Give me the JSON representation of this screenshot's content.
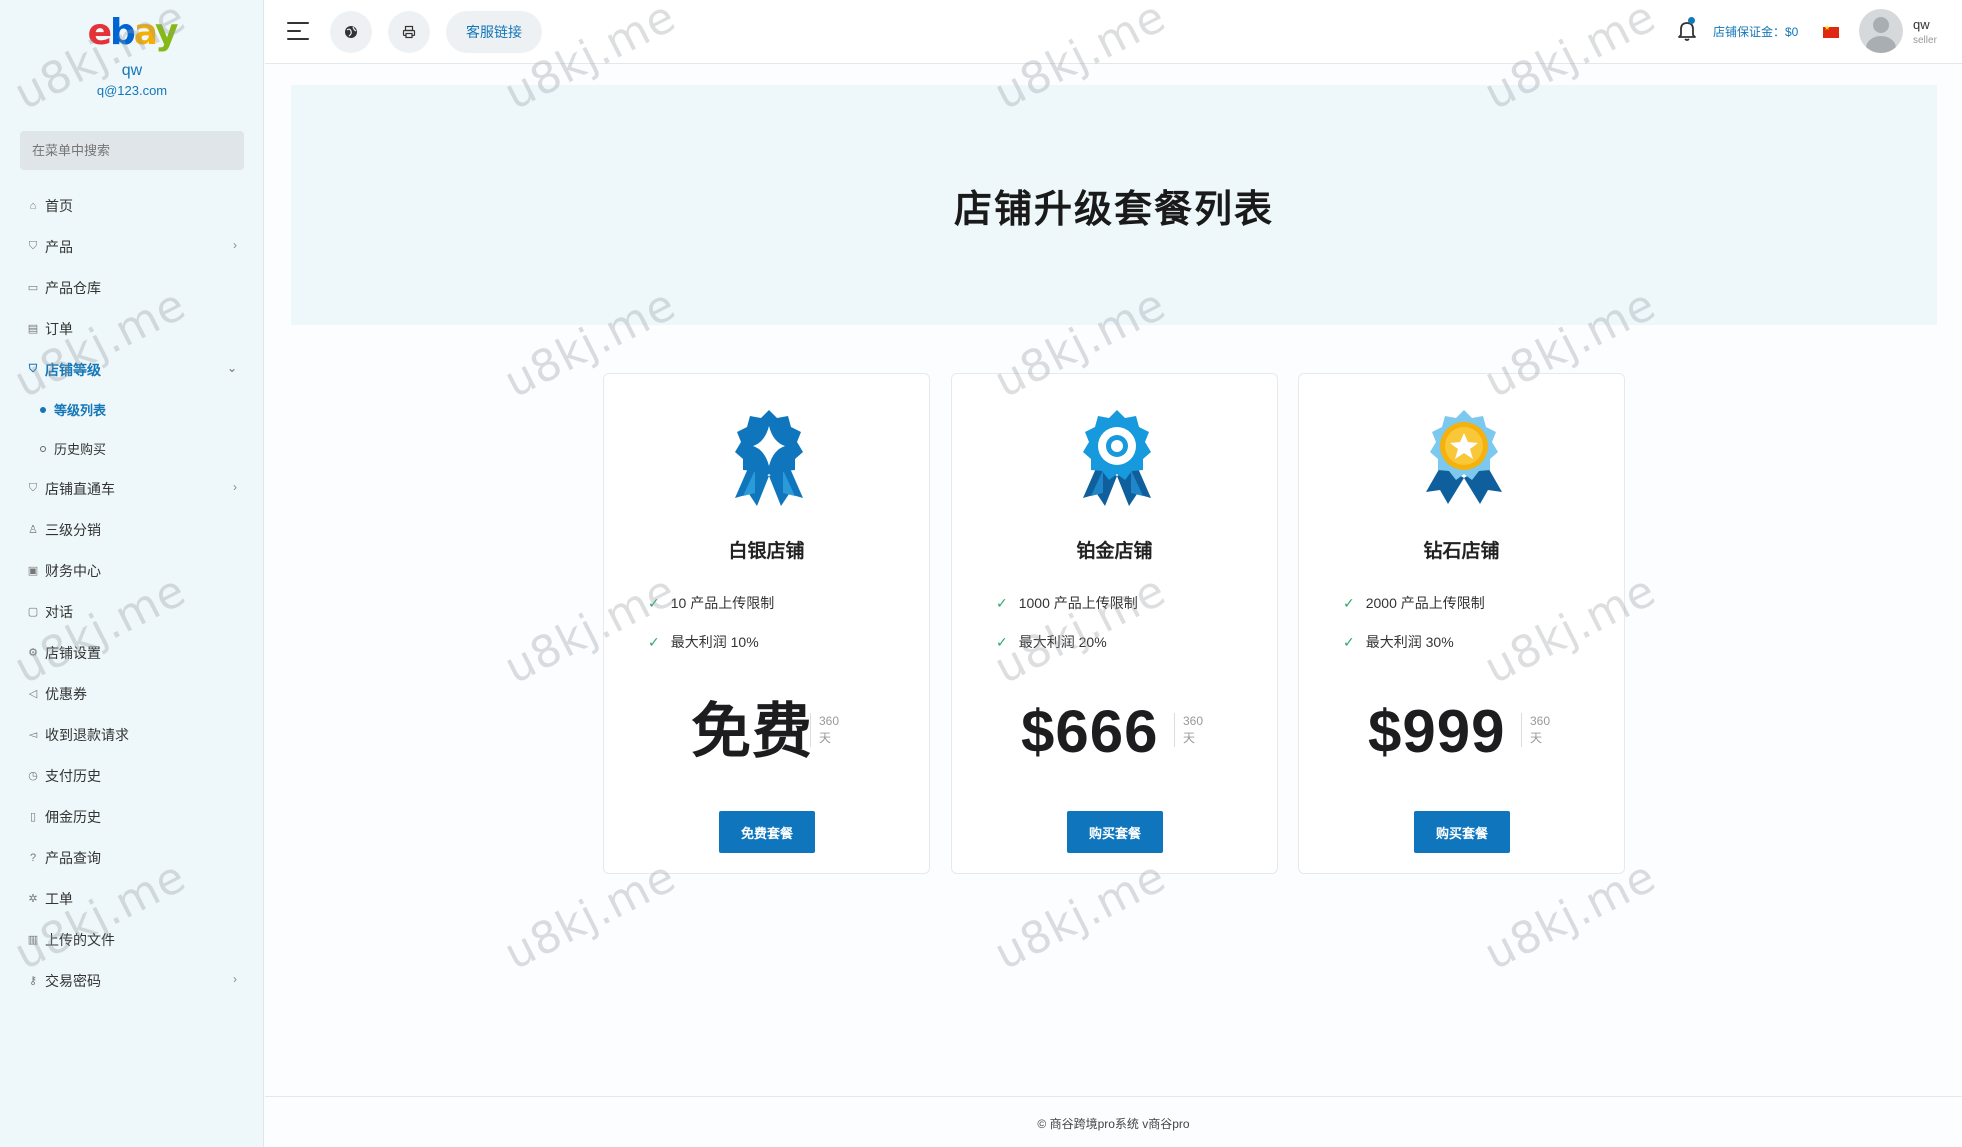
{
  "sidebar": {
    "logo": {
      "e": "e",
      "b": "b",
      "a": "a",
      "y": "y"
    },
    "user_name": "qw",
    "user_email": "q@123.com",
    "search_placeholder": "在菜单中搜索",
    "items": [
      {
        "label": "首页",
        "icon": "home-icon"
      },
      {
        "label": "产品",
        "icon": "cart-icon",
        "expandable": true
      },
      {
        "label": "产品仓库",
        "icon": "warehouse-icon"
      },
      {
        "label": "订单",
        "icon": "order-icon"
      },
      {
        "label": "店铺等级",
        "icon": "cart-icon",
        "expandable": true,
        "expanded": true,
        "active": true,
        "children": [
          {
            "label": "等级列表",
            "active": true
          },
          {
            "label": "历史购买"
          }
        ]
      },
      {
        "label": "店铺直通车",
        "icon": "cart-icon",
        "expandable": true
      },
      {
        "label": "三级分销",
        "icon": "user-icon"
      },
      {
        "label": "财务中心",
        "icon": "money-icon"
      },
      {
        "label": "对话",
        "icon": "chat-icon"
      },
      {
        "label": "店铺设置",
        "icon": "gear-icon"
      },
      {
        "label": "优惠券",
        "icon": "megaphone-icon"
      },
      {
        "label": "收到退款请求",
        "icon": "refund-icon"
      },
      {
        "label": "支付历史",
        "icon": "clock-icon"
      },
      {
        "label": "佣金历史",
        "icon": "document-icon"
      },
      {
        "label": "产品查询",
        "icon": "question-icon"
      },
      {
        "label": "工单",
        "icon": "settings-icon"
      },
      {
        "label": "上传的文件",
        "icon": "folder-icon"
      },
      {
        "label": "交易密码",
        "icon": "key-icon",
        "expandable": true
      }
    ]
  },
  "header": {
    "cs_link": "客服链接",
    "deposit": "店铺保证金：$0",
    "user_name": "qw",
    "user_role": "seller"
  },
  "page": {
    "title": "店铺升级套餐列表"
  },
  "plans": [
    {
      "name": "白银店铺",
      "features": [
        "10 产品上传限制",
        "最大利润 10%"
      ],
      "price": "免费",
      "period_num": "360",
      "period_unit": "天",
      "button": "免费套餐"
    },
    {
      "name": "铂金店铺",
      "features": [
        "1000 产品上传限制",
        "最大利润 20%"
      ],
      "price": "$666",
      "period_num": "360",
      "period_unit": "天",
      "button": "购买套餐"
    },
    {
      "name": "钻石店铺",
      "features": [
        "2000 产品上传限制",
        "最大利润 30%"
      ],
      "price": "$999",
      "period_num": "360",
      "period_unit": "天",
      "button": "购买套餐"
    }
  ],
  "footer": "© 商谷跨境pro系统 v商谷pro",
  "watermark": "u8kj.me",
  "colors": {
    "accent": "#1477b8",
    "button": "#0f76bd",
    "check": "#2ea76d"
  }
}
